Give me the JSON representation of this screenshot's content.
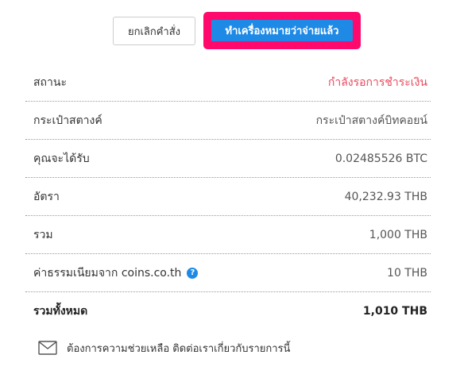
{
  "actions": {
    "cancel_label": "ยกเลิกคำสั่ง",
    "confirm_label": "ทำเครื่องหมายว่าจ่ายแล้ว"
  },
  "details": {
    "rows": [
      {
        "label": "สถานะ",
        "value": "กำลังรอการชำระเงิน"
      },
      {
        "label": "กระเป๋าสตางค์",
        "value": "กระเป๋าสตางค์บิทคอยน์"
      },
      {
        "label": "คุณจะได้รับ",
        "value": "0.02485526 BTC"
      },
      {
        "label": "อัตรา",
        "value": "40,232.93 THB"
      },
      {
        "label": "รวม",
        "value": "1,000 THB"
      },
      {
        "label": "ค่าธรรมเนียมจาก coins.co.th",
        "value": "10 THB",
        "help_icon": "?"
      },
      {
        "label": "รวมทั้งหมด",
        "value": "1,010 THB"
      }
    ]
  },
  "support": {
    "icon": "mail-icon",
    "text": "ต้องการความช่วยเหลือ ติดต่อเราเกี่ยวกับรายการนี้"
  },
  "colors": {
    "confirm_button": "#1e8ae6",
    "highlight_outline": "#ff0a6c",
    "pending_status": "#e8485d"
  }
}
